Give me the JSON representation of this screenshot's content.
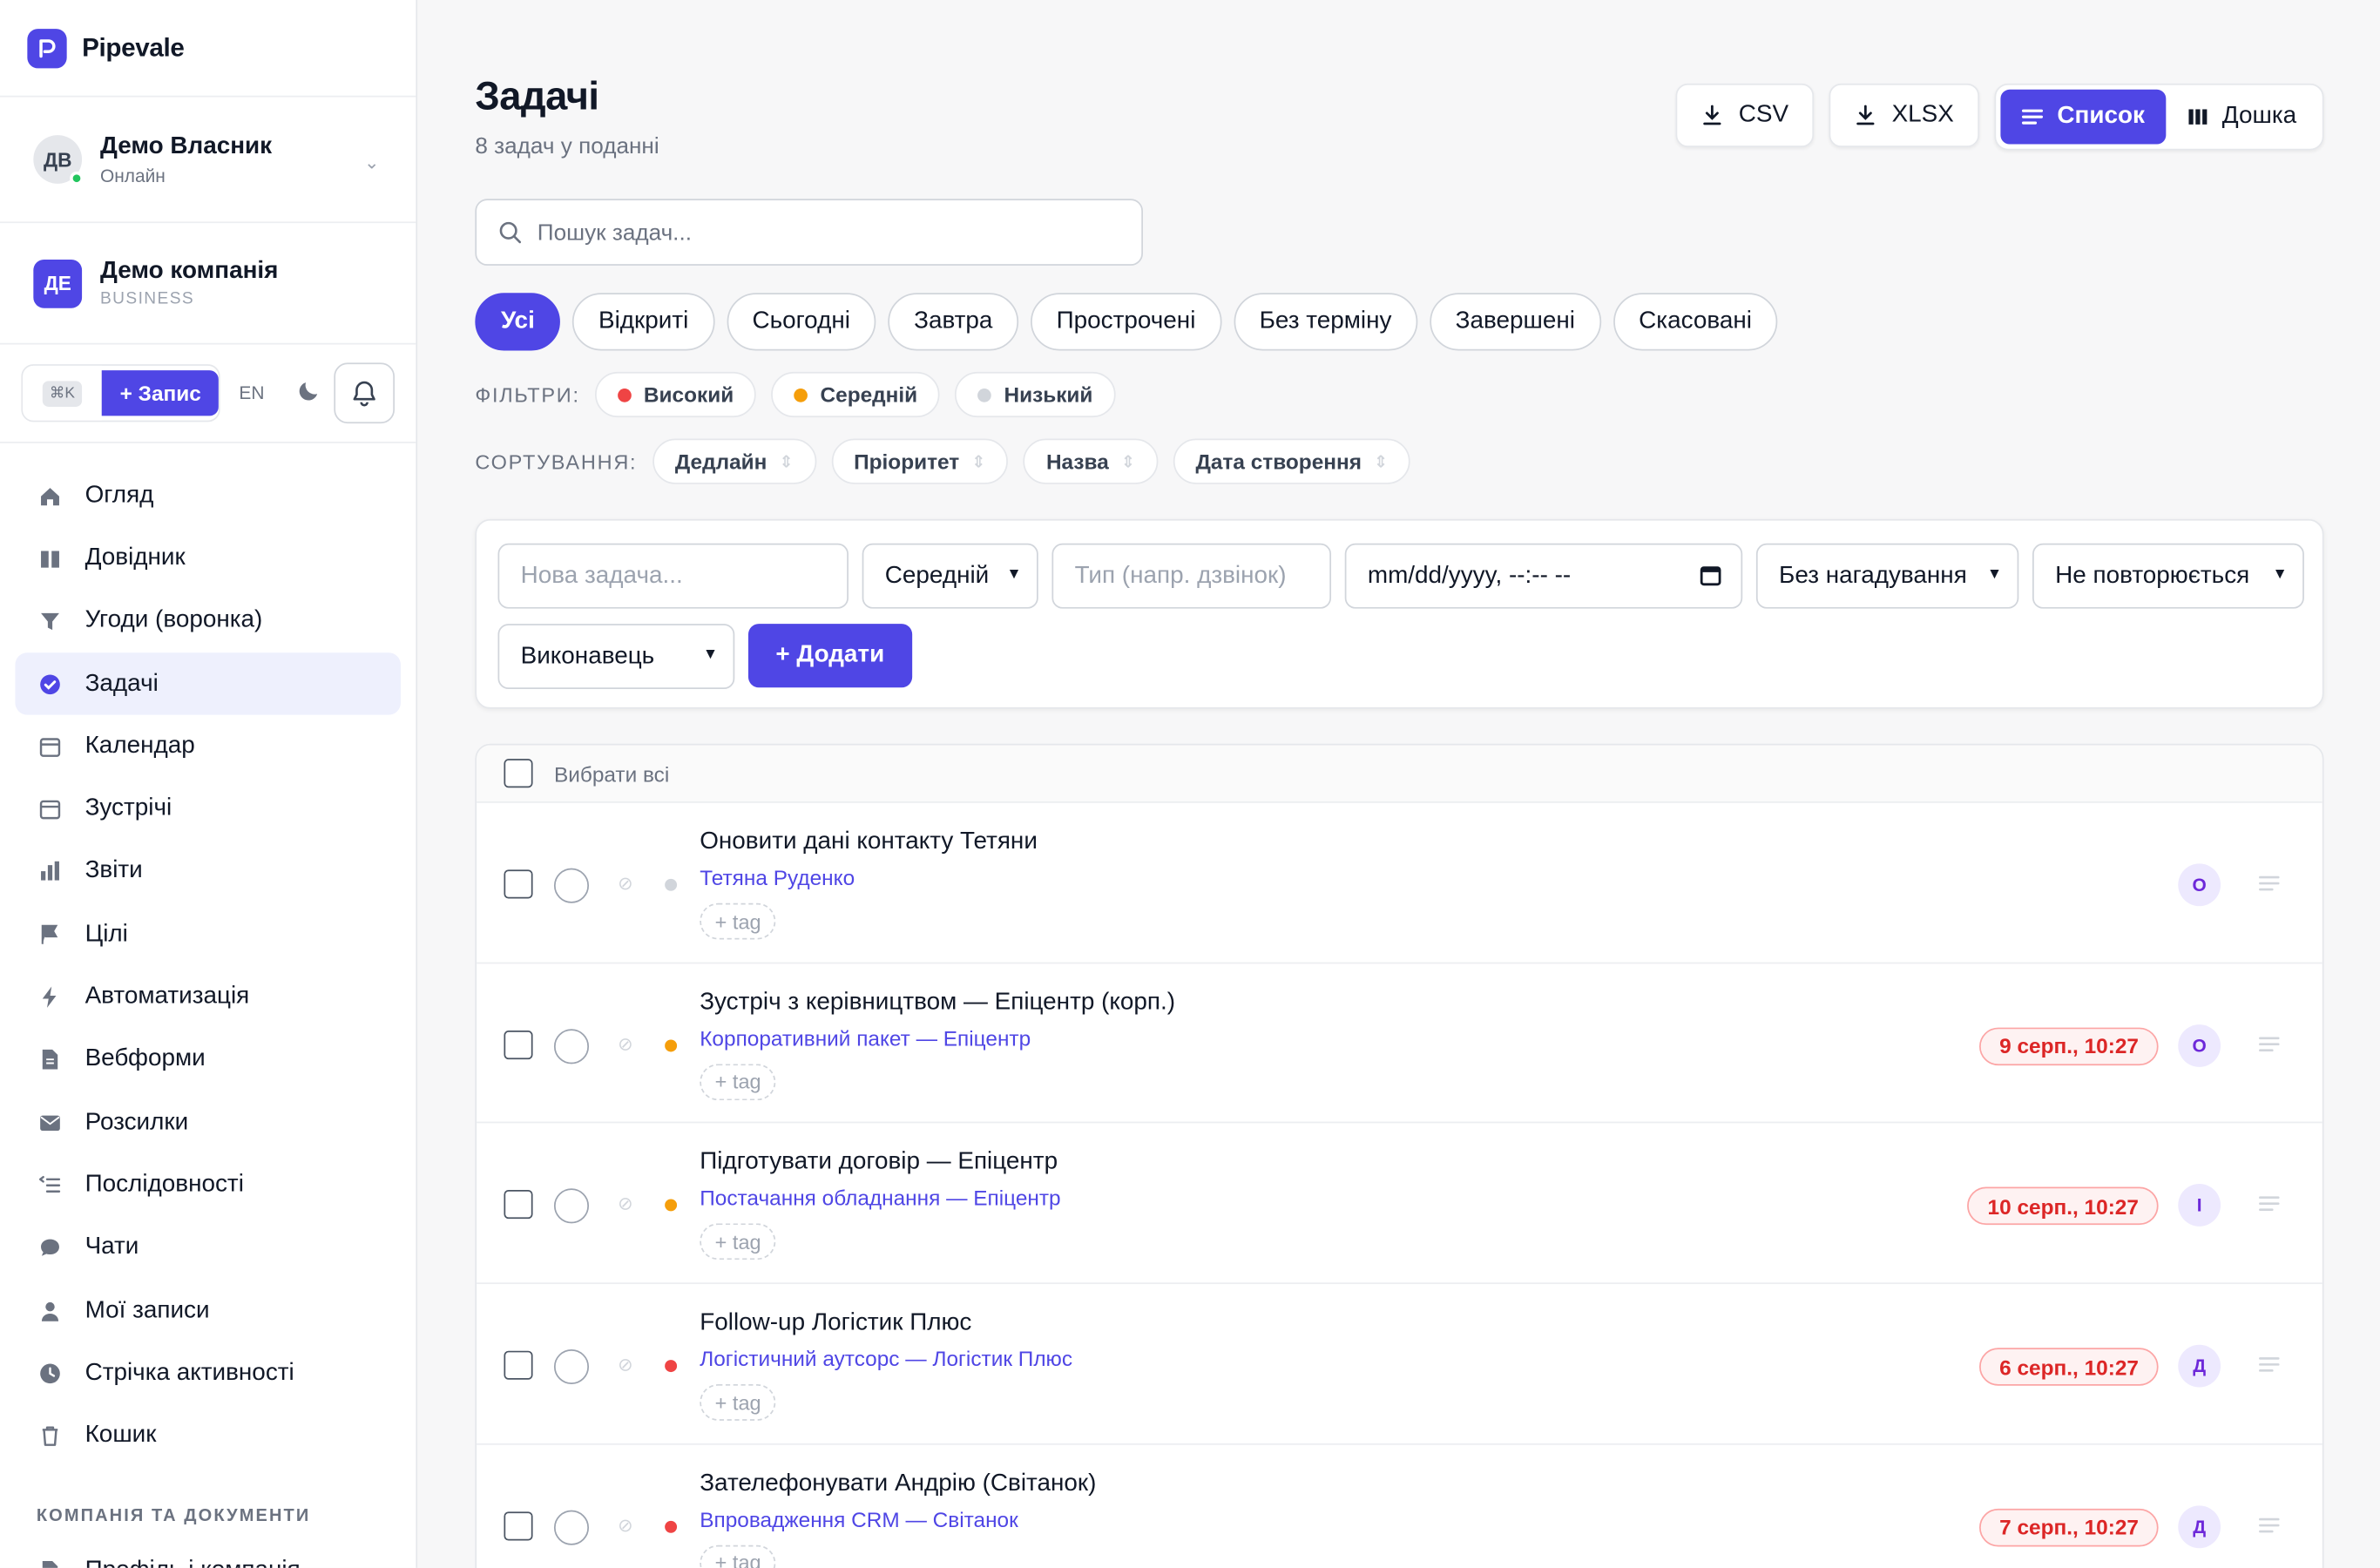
{
  "app": {
    "brand": "Pipevale"
  },
  "user": {
    "initials": "ДВ",
    "name": "Демо Власник",
    "status": "Онлайн"
  },
  "company": {
    "initials": "ДЕ",
    "name": "Демо компанія",
    "plan": "BUSINESS"
  },
  "actions": {
    "shortcut": "⌘K",
    "record_label": "+ Запис",
    "lang": "EN"
  },
  "nav": {
    "items": [
      {
        "label": "Огляд",
        "icon": "home-icon"
      },
      {
        "label": "Довідник",
        "icon": "book-icon"
      },
      {
        "label": "Угоди (воронка)",
        "icon": "funnel-icon"
      },
      {
        "label": "Задачі",
        "icon": "check-circle-icon",
        "active": true
      },
      {
        "label": "Календар",
        "icon": "calendar-icon"
      },
      {
        "label": "Зустрічі",
        "icon": "calendar-icon"
      },
      {
        "label": "Звіти",
        "icon": "bar-chart-icon"
      },
      {
        "label": "Цілі",
        "icon": "flag-icon"
      },
      {
        "label": "Автоматизація",
        "icon": "bolt-icon"
      },
      {
        "label": "Вебформи",
        "icon": "document-icon"
      },
      {
        "label": "Розсилки",
        "icon": "mail-icon"
      },
      {
        "label": "Послідовності",
        "icon": "list-icon"
      },
      {
        "label": "Чати",
        "icon": "chat-icon"
      },
      {
        "label": "Мої записи",
        "icon": "user-icon"
      },
      {
        "label": "Стрічка активності",
        "icon": "clock-icon"
      },
      {
        "label": "Кошик",
        "icon": "trash-icon"
      }
    ],
    "section_title": "КОМПАНІЯ ТА ДОКУМЕНТИ",
    "section_items": [
      {
        "label": "Профіль і компанія",
        "icon": "document-icon"
      }
    ]
  },
  "page": {
    "title": "Задачі",
    "subtitle": "8 задач у поданні"
  },
  "toolbar": {
    "csv_label": "CSV",
    "xlsx_label": "XLSX",
    "list_label": "Список",
    "board_label": "Дошка"
  },
  "search": {
    "placeholder": "Пошук задач..."
  },
  "tabs": [
    "Усі",
    "Відкриті",
    "Сьогодні",
    "Завтра",
    "Прострочені",
    "Без терміну",
    "Завершені",
    "Скасовані"
  ],
  "filters": {
    "label": "ФІЛЬТРИ:",
    "items": [
      {
        "label": "Високий",
        "color": "#ef4444"
      },
      {
        "label": "Середній",
        "color": "#f59e0b"
      },
      {
        "label": "Низький",
        "color": "#d1d5db"
      }
    ]
  },
  "sort": {
    "label": "СОРТУВАННЯ:",
    "items": [
      "Дедлайн",
      "Пріоритет",
      "Назва",
      "Дата створення"
    ]
  },
  "new_task": {
    "title_placeholder": "Нова задача...",
    "priority": "Середній",
    "type_placeholder": "Тип (напр. дзвінок)",
    "datetime_placeholder": "mm/dd/yyyy, --:-- --",
    "reminder": "Без нагадування",
    "repeat": "Не повторюється",
    "assignee": "Виконавець",
    "add_label": "+ Додати"
  },
  "list": {
    "select_all": "Вибрати всі",
    "tag_label": "+ tag",
    "tasks": [
      {
        "title": "Оновити дані контакту Тетяни",
        "link": "Тетяна Руденко",
        "priority_color": "#d1d5db",
        "due": "",
        "assignee": "О"
      },
      {
        "title": "Зустріч з керівництвом — Епіцентр (корп.)",
        "link": "Корпоративний пакет — Епіцентр",
        "priority_color": "#f59e0b",
        "due": "9 серп., 10:27",
        "assignee": "О"
      },
      {
        "title": "Підготувати договір — Епіцентр",
        "link": "Постачання обладнання — Епіцентр",
        "priority_color": "#f59e0b",
        "due": "10 серп., 10:27",
        "assignee": "І"
      },
      {
        "title": "Follow-up Логістик Плюс",
        "link": "Логістичний аутсорс — Логістик Плюс",
        "priority_color": "#ef4444",
        "due": "6 серп., 10:27",
        "assignee": "Д"
      },
      {
        "title": "Зателефонувати Андрію (Світанок)",
        "link": "Впровадження CRM — Світанок",
        "priority_color": "#ef4444",
        "due": "7 серп., 10:27",
        "assignee": "Д"
      }
    ]
  },
  "colors": {
    "accent": "#4f46e5",
    "danger": "#dc2626"
  }
}
